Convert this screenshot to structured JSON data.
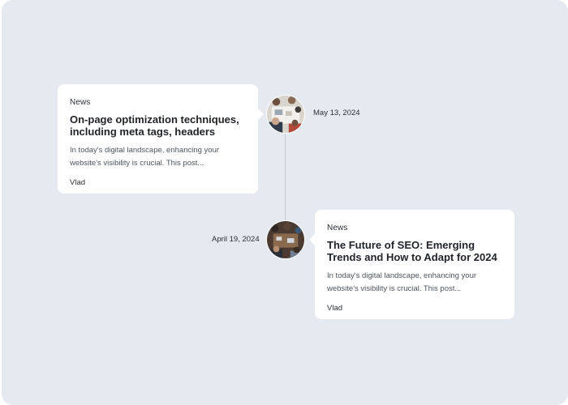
{
  "timeline": {
    "posts": [
      {
        "category": "News",
        "title": "On-page optimization techniques, including meta tags, headers",
        "excerpt": "In today's digital landscape, enhancing your website's visibility is crucial. This post...",
        "author": "Vlad",
        "date": "May 13, 2024",
        "image_icon": "team-meeting-photo-icon"
      },
      {
        "category": "News",
        "title": "The Future of SEO: Emerging Trends and How to Adapt for 2024",
        "excerpt": "In today's digital landscape, enhancing your website's visibility is crucial. This post...",
        "author": "Vlad",
        "date": "April 19, 2024",
        "image_icon": "office-meeting-photo-icon"
      }
    ]
  },
  "colors": {
    "background": "#e5e9f0",
    "card": "#ffffff",
    "text": "#1f2329",
    "muted_text": "#4d5560",
    "line": "#c3c8d0"
  }
}
